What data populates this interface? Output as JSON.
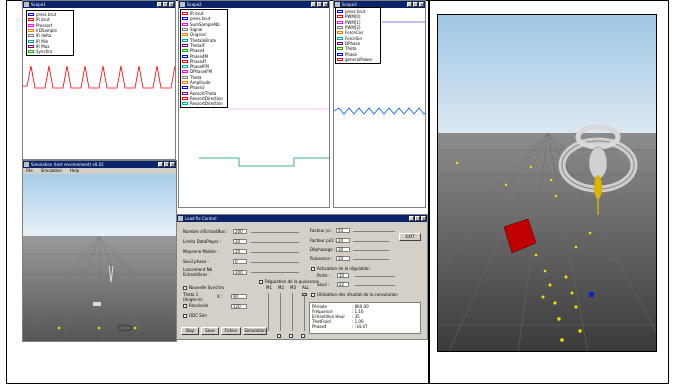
{
  "win_scope1": {
    "title": "Scope1",
    "legend": [
      {
        "label": "press brut",
        "color": "#0000ff"
      },
      {
        "label": "IR brut",
        "color": "#ff0000"
      },
      {
        "label": "Pressort",
        "color": "#ff00ff"
      },
      {
        "label": "IrDSample",
        "color": "#ff8000"
      },
      {
        "label": "IR delta",
        "color": "#808080"
      },
      {
        "label": "IR Min",
        "color": "#00aaaa"
      },
      {
        "label": "IR Max",
        "color": "#800080"
      },
      {
        "label": "Synchro",
        "color": "#00c000"
      }
    ]
  },
  "win_scope2": {
    "title": "Scope2",
    "legend": [
      {
        "label": "IR brut",
        "color": "#ff0000"
      },
      {
        "label": "press brut",
        "color": "#0000ff"
      },
      {
        "label": "SumSampleNb",
        "color": "#ff00ff"
      },
      {
        "label": "Signal",
        "color": "#808080"
      },
      {
        "label": "Original",
        "color": "#ff8000"
      },
      {
        "label": "ThetaInBrute",
        "color": "#00aaaa"
      },
      {
        "label": "ThetaIF",
        "color": "#800080"
      },
      {
        "label": "Phase4",
        "color": "#00c000"
      },
      {
        "label": "Phase4M",
        "color": "#0000ff"
      },
      {
        "label": "Phase4f",
        "color": "#ff0000"
      },
      {
        "label": "PhaseIFM",
        "color": "#00aaaa"
      },
      {
        "label": "DPhaseIFM",
        "color": "#ff00ff"
      },
      {
        "label": "Theta",
        "color": "#808080"
      },
      {
        "label": "Amplitude",
        "color": "#ff8000"
      },
      {
        "label": "Phase3",
        "color": "#0000ff"
      },
      {
        "label": "RessortTheta",
        "color": "#800080"
      },
      {
        "label": "RessortDirection",
        "color": "#ff0000"
      },
      {
        "label": "RessortDirection",
        "color": "#00aaaa"
      }
    ]
  },
  "win_scope3": {
    "title": "Scope3",
    "legend": [
      {
        "label": "press brut",
        "color": "#0000ff"
      },
      {
        "label": "PWM[0]",
        "color": "#ff0000"
      },
      {
        "label": "PWM[1]",
        "color": "#ff00ff"
      },
      {
        "label": "PWM[2]",
        "color": "#808080"
      },
      {
        "label": "ForceCos",
        "color": "#ff8000"
      },
      {
        "label": "ForceSin",
        "color": "#00aaaa"
      },
      {
        "label": "DPhase",
        "color": "#800080"
      },
      {
        "label": "Theta",
        "color": "#00c000"
      },
      {
        "label": "Phase",
        "color": "#0000ff"
      },
      {
        "label": "generalPower",
        "color": "#ff0000"
      }
    ]
  },
  "win_sim": {
    "title": "Simulation (test environment) v0.02",
    "menu": [
      "File",
      "Simulation",
      "Help"
    ]
  },
  "ctrl": {
    "title": "Load fix Control",
    "left_fields": [
      {
        "label": "Nombre d'EchantBox :",
        "value": "200"
      },
      {
        "label": "Limite DataPlayer :",
        "value": "20"
      },
      {
        "label": "Moyenne Mobile :",
        "value": "20"
      },
      {
        "label": "Seuil phase :",
        "value": "0"
      },
      {
        "label": "Lancement Nb Echantillons :",
        "value": "200"
      }
    ],
    "right_fields": [
      {
        "label": "Facteur pi :",
        "value": "50"
      },
      {
        "label": "Facteur pi/2 :",
        "value": "20"
      },
      {
        "label": "Déphasage :",
        "value": "30"
      },
      {
        "label": "Puissance :",
        "value": "10"
      }
    ],
    "exit": "EXIT",
    "reg_puissance": "Régulation de la puissance",
    "activation": "Activation de la régulation",
    "perte_label": "Perte :",
    "perte_value": "10",
    "seuil_label": "Seuil :",
    "seuil_value": "22",
    "utilisation": "Utilisation des résultat de la convolution",
    "nouvelle": "Nouvelle Synchro",
    "theta_label": "Theta 1 (Angle-m)",
    "x_label": "X :",
    "x_value": "90",
    "recalcule": "Recalcule",
    "v_value": "120",
    "odc_label": "ODC Sim",
    "h_labels": [
      "M1",
      "M2",
      "M3",
      "ALL"
    ],
    "results": [
      {
        "k": "Période",
        "v": ": 860.00"
      },
      {
        "k": "Fréquence",
        "v": ": 1.16"
      },
      {
        "k": "Echantillon Hour",
        "v": ": 35"
      },
      {
        "k": "ThetFroid",
        "v": ": 1.00"
      },
      {
        "k": "Phase4",
        "v": ": -34.47"
      }
    ],
    "buttons": [
      "Stop",
      "Save",
      "Fichier",
      "Simulation"
    ]
  }
}
